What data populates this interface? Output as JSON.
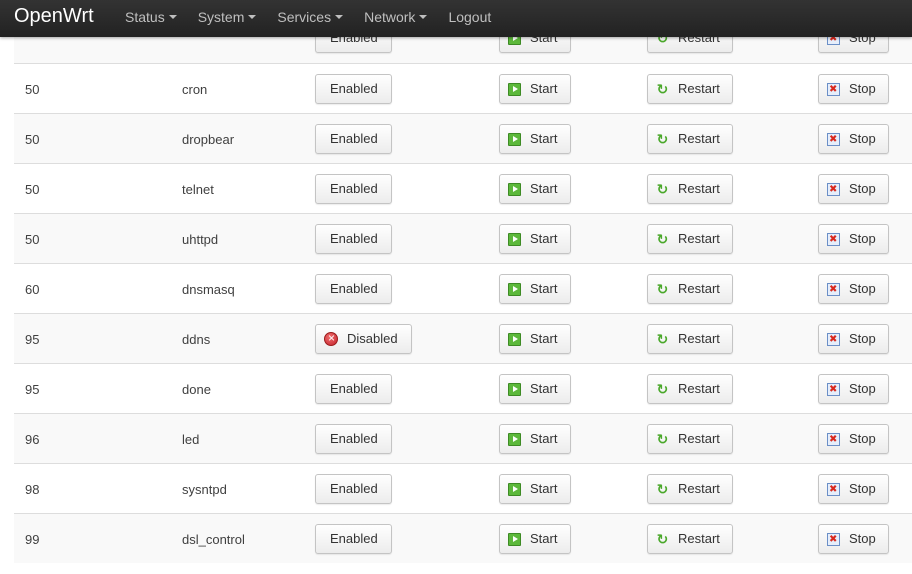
{
  "navbar": {
    "brand": "OpenWrt",
    "items": [
      {
        "label": "Status",
        "dropdown": true
      },
      {
        "label": "System",
        "dropdown": true
      },
      {
        "label": "Services",
        "dropdown": true
      },
      {
        "label": "Network",
        "dropdown": true
      },
      {
        "label": "Logout",
        "dropdown": false
      }
    ]
  },
  "actions": {
    "start": "Start",
    "restart": "Restart",
    "stop": "Stop"
  },
  "icons": {
    "start": "play-icon",
    "restart": "reload-icon",
    "stop": "stop-icon",
    "disabled": "disabled-icon"
  },
  "rows": [
    {
      "priority": "",
      "name": "",
      "state": "Enabled"
    },
    {
      "priority": "50",
      "name": "cron",
      "state": "Enabled"
    },
    {
      "priority": "50",
      "name": "dropbear",
      "state": "Enabled"
    },
    {
      "priority": "50",
      "name": "telnet",
      "state": "Enabled"
    },
    {
      "priority": "50",
      "name": "uhttpd",
      "state": "Enabled"
    },
    {
      "priority": "60",
      "name": "dnsmasq",
      "state": "Enabled"
    },
    {
      "priority": "95",
      "name": "ddns",
      "state": "Disabled"
    },
    {
      "priority": "95",
      "name": "done",
      "state": "Enabled"
    },
    {
      "priority": "96",
      "name": "led",
      "state": "Enabled"
    },
    {
      "priority": "98",
      "name": "sysntpd",
      "state": "Enabled"
    },
    {
      "priority": "99",
      "name": "dsl_control",
      "state": "Enabled"
    }
  ]
}
